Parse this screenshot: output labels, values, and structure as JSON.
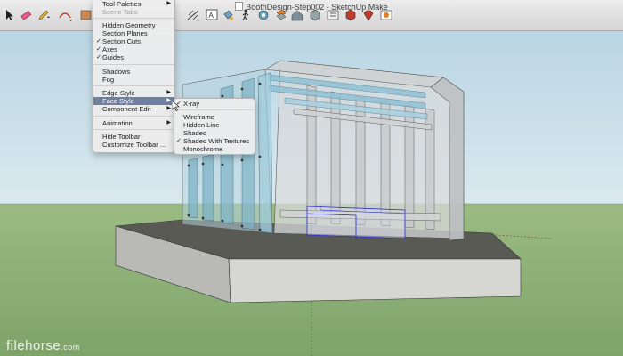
{
  "window": {
    "title": "BoothDesign-Step002 - SketchUp Make"
  },
  "toolbar": {
    "tools": [
      {
        "name": "select-tool",
        "icon": "arrow-cursor-icon"
      },
      {
        "name": "eraser-tool",
        "icon": "eraser-icon"
      },
      {
        "name": "pencil-tool",
        "icon": "pencil-icon"
      },
      {
        "name": "arc-tool",
        "icon": "arc-icon"
      },
      {
        "name": "rectangle-tool",
        "icon": "rectangle-icon"
      },
      {
        "name": "dimension-tool",
        "icon": "dimension-icon"
      },
      {
        "name": "text-tool",
        "icon": "text-icon"
      },
      {
        "name": "paint-bucket-tool",
        "icon": "paint-bucket-icon"
      },
      {
        "name": "walk-tool",
        "icon": "walk-icon"
      },
      {
        "name": "position-camera-tool",
        "icon": "camera-icon"
      },
      {
        "name": "section-plane-tool",
        "icon": "section-plane-icon"
      },
      {
        "name": "warehouse-tool",
        "icon": "warehouse-icon"
      },
      {
        "name": "components-tool",
        "icon": "components-icon"
      },
      {
        "name": "extension-tool",
        "icon": "extension-icon"
      },
      {
        "name": "share-model-tool",
        "icon": "share-model-icon"
      },
      {
        "name": "ruby-tool",
        "icon": "ruby-icon"
      },
      {
        "name": "layout-tool",
        "icon": "layout-icon"
      }
    ]
  },
  "view_menu": {
    "items": [
      {
        "label": "Tool Palettes",
        "checked": false,
        "submenu": true,
        "dim": false
      },
      {
        "label": "Scene Tabs",
        "checked": false,
        "submenu": false,
        "dim": true
      },
      {
        "label": "Hidden Geometry",
        "checked": false,
        "submenu": false,
        "dim": false
      },
      {
        "label": "Section Planes",
        "checked": false,
        "submenu": false,
        "dim": false
      },
      {
        "label": "Section Cuts",
        "checked": true,
        "submenu": false,
        "dim": false
      },
      {
        "label": "Axes",
        "checked": true,
        "submenu": false,
        "dim": false
      },
      {
        "label": "Guides",
        "checked": true,
        "submenu": false,
        "dim": false
      },
      {
        "label": "Shadows",
        "checked": false,
        "submenu": false,
        "dim": false
      },
      {
        "label": "Fog",
        "checked": false,
        "submenu": false,
        "dim": false
      },
      {
        "label": "Edge Style",
        "checked": false,
        "submenu": true,
        "dim": false
      },
      {
        "label": "Face Style",
        "checked": false,
        "submenu": true,
        "dim": false,
        "highlighted": true
      },
      {
        "label": "Component Edit",
        "checked": false,
        "submenu": true,
        "dim": false
      },
      {
        "label": "Animation",
        "checked": false,
        "submenu": true,
        "dim": false
      },
      {
        "label": "Hide Toolbar",
        "checked": false,
        "submenu": false,
        "dim": false
      },
      {
        "label": "Customize Toolbar ...",
        "checked": false,
        "submenu": false,
        "dim": false
      }
    ],
    "check_glyph": "✓",
    "arrow_glyph": "▶"
  },
  "face_style_submenu": {
    "items": [
      {
        "label": "X-ray",
        "checked": true
      },
      {
        "label": "Wireframe",
        "checked": false
      },
      {
        "label": "Hidden Line",
        "checked": false
      },
      {
        "label": "Shaded",
        "checked": false
      },
      {
        "label": "Shaded With Textures",
        "checked": true
      },
      {
        "label": "Monochrome",
        "checked": false
      }
    ]
  },
  "watermark": {
    "name": "filehorse",
    "suffix": ".com"
  },
  "colors": {
    "sky": "#c8dfe9",
    "ground": "#8aab73",
    "menu_highlight": "#6e7fa0",
    "glass": "#9cc6d6",
    "selection": "#2b2bd0"
  }
}
